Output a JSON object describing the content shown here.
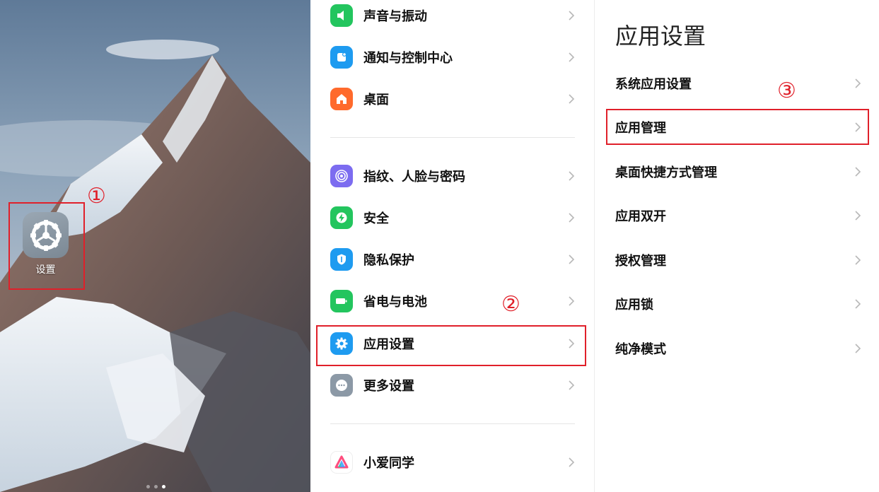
{
  "home": {
    "settings_app_label": "设置",
    "step_mark": "①",
    "wallpaper": "snow-mountain-wallpaper"
  },
  "settings": {
    "items": [
      {
        "label": "声音与振动",
        "icon": "sound-icon",
        "color": "#23c55e"
      },
      {
        "label": "通知与控制中心",
        "icon": "notification-icon",
        "color": "#1e9bf0"
      },
      {
        "label": "桌面",
        "icon": "home-icon",
        "color": "#ff6a2c"
      },
      {
        "label": "指纹、人脸与密码",
        "icon": "fingerprint-icon",
        "color": "#7c6cf0"
      },
      {
        "label": "安全",
        "icon": "security-icon",
        "color": "#23c55e"
      },
      {
        "label": "隐私保护",
        "icon": "privacy-icon",
        "color": "#1e9bf0"
      },
      {
        "label": "省电与电池",
        "icon": "battery-icon",
        "color": "#23c55e"
      },
      {
        "label": "应用设置",
        "icon": "gear-icon",
        "color": "#1e9bf0"
      },
      {
        "label": "更多设置",
        "icon": "more-icon",
        "color": "#8c99a6"
      },
      {
        "label": "小爱同学",
        "icon": "xiaoai-icon",
        "color": "#ffffff"
      }
    ],
    "step_mark": "②"
  },
  "app_settings": {
    "title": "应用设置",
    "items": [
      {
        "label": "系统应用设置"
      },
      {
        "label": "应用管理"
      },
      {
        "label": "桌面快捷方式管理"
      },
      {
        "label": "应用双开"
      },
      {
        "label": "授权管理"
      },
      {
        "label": "应用锁"
      },
      {
        "label": "纯净模式"
      }
    ],
    "step_mark": "③"
  },
  "colors": {
    "highlight": "#e0202a",
    "chevron": "#b8b8b8"
  }
}
